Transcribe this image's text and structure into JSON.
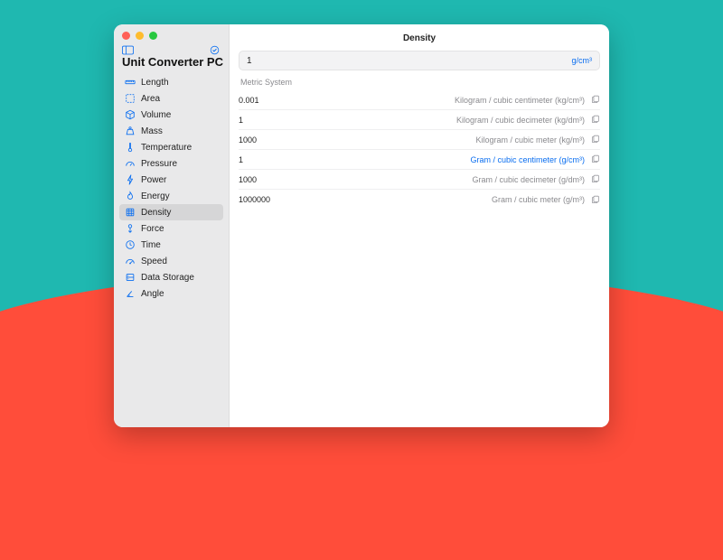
{
  "app": {
    "title": "Unit Converter PC"
  },
  "sidebar": {
    "items": [
      {
        "icon": "ruler",
        "label": "Length"
      },
      {
        "icon": "square-dashed",
        "label": "Area"
      },
      {
        "icon": "cube",
        "label": "Volume"
      },
      {
        "icon": "scalemass",
        "label": "Mass"
      },
      {
        "icon": "thermometer",
        "label": "Temperature"
      },
      {
        "icon": "gauge",
        "label": "Pressure"
      },
      {
        "icon": "bolt",
        "label": "Power"
      },
      {
        "icon": "flame",
        "label": "Energy"
      },
      {
        "icon": "density",
        "label": "Density",
        "selected": true
      },
      {
        "icon": "force",
        "label": "Force"
      },
      {
        "icon": "clock",
        "label": "Time"
      },
      {
        "icon": "speedometer",
        "label": "Speed"
      },
      {
        "icon": "storage",
        "label": "Data Storage"
      },
      {
        "icon": "angle",
        "label": "Angle"
      }
    ]
  },
  "main": {
    "title": "Density",
    "input_value": "1",
    "input_unit": "g/cm³",
    "section": "Metric System",
    "rows": [
      {
        "value": "0.001",
        "label": "Kilogram / cubic centimeter (kg/cm³)"
      },
      {
        "value": "1",
        "label": "Kilogram / cubic decimeter (kg/dm³)"
      },
      {
        "value": "1000",
        "label": "Kilogram / cubic meter (kg/m³)"
      },
      {
        "value": "1",
        "label": "Gram / cubic centimeter (g/cm³)",
        "active": true
      },
      {
        "value": "1000",
        "label": "Gram / cubic decimeter (g/dm³)"
      },
      {
        "value": "1000000",
        "label": "Gram / cubic meter (g/m³)"
      }
    ]
  }
}
